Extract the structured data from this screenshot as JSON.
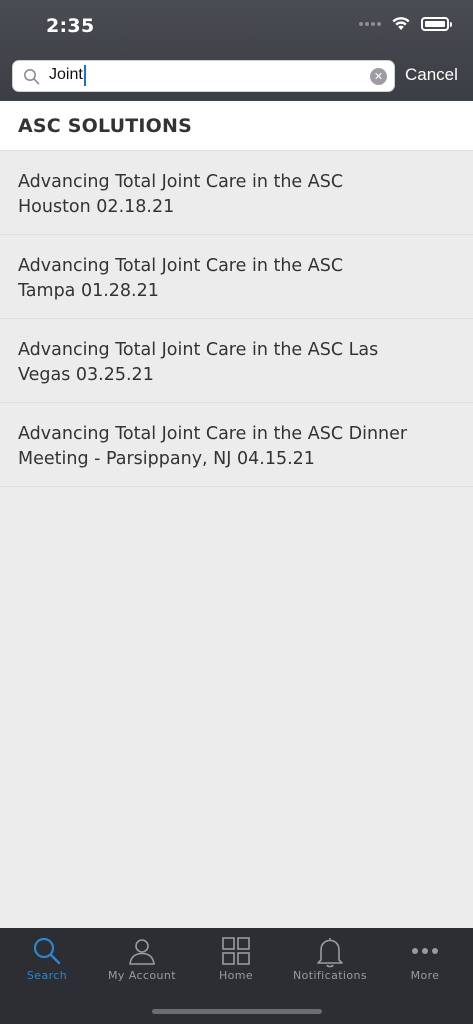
{
  "status_bar": {
    "time": "2:35"
  },
  "search": {
    "value": "Joint",
    "cancel_label": "Cancel"
  },
  "section": {
    "title": "ASC SOLUTIONS"
  },
  "results": [
    {
      "line1": "Advancing Total Joint Care in the ASC",
      "line2": "Houston 02.18.21"
    },
    {
      "line1": "Advancing Total Joint Care in the ASC",
      "line2": "Tampa 01.28.21"
    },
    {
      "line1": "Advancing Total Joint Care in the ASC Las",
      "line2": "Vegas 03.25.21"
    },
    {
      "line1": "Advancing Total Joint Care in the ASC Dinner",
      "line2": "Meeting - Parsippany, NJ 04.15.21"
    }
  ],
  "tabs": [
    {
      "label": "Search",
      "icon": "search-icon",
      "active": true
    },
    {
      "label": "My Account",
      "icon": "person-icon",
      "active": false
    },
    {
      "label": "Home",
      "icon": "grid-icon",
      "active": false
    },
    {
      "label": "Notifications",
      "icon": "bell-icon",
      "active": false
    },
    {
      "label": "More",
      "icon": "more-dots-icon",
      "active": false
    }
  ],
  "colors": {
    "header_bg": "#3c3e45",
    "accent": "#2a86d1",
    "tabbar_bg": "#2c2e33",
    "list_bg": "#ececec"
  }
}
